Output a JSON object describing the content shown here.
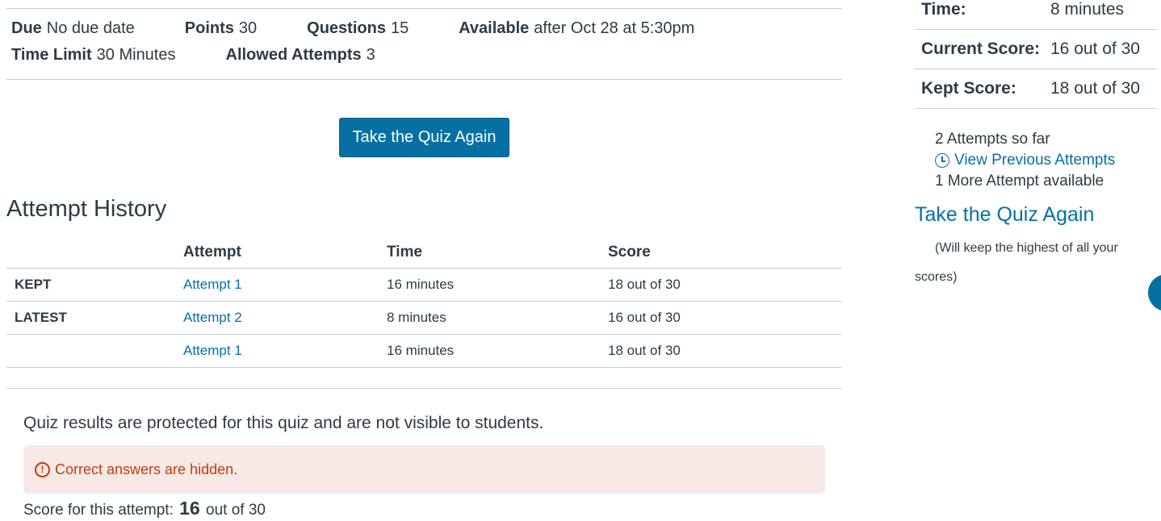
{
  "quiz_details": {
    "due_label": "Due",
    "due_value": "No due date",
    "points_label": "Points",
    "points_value": "30",
    "questions_label": "Questions",
    "questions_value": "15",
    "available_label": "Available",
    "available_value": "after Oct 28 at 5:30pm",
    "time_limit_label": "Time Limit",
    "time_limit_value": "30 Minutes",
    "allowed_attempts_label": "Allowed Attempts",
    "allowed_attempts_value": "3"
  },
  "take_quiz_button_label": "Take the Quiz Again",
  "attempt_history": {
    "title": "Attempt History",
    "columns": [
      "",
      "Attempt",
      "Time",
      "Score"
    ],
    "rows": [
      {
        "tag": "KEPT",
        "attempt": "Attempt 1",
        "time": "16 minutes",
        "score": "18 out of 30"
      },
      {
        "tag": "LATEST",
        "attempt": "Attempt 2",
        "time": "8 minutes",
        "score": "16 out of 30"
      },
      {
        "tag": "",
        "attempt": "Attempt 1",
        "time": "16 minutes",
        "score": "18 out of 30"
      }
    ]
  },
  "results": {
    "protected_text": "Quiz results are protected for this quiz and are not visible to students.",
    "alert_text": "Correct answers are hidden.",
    "score_prefix": "Score for this attempt:",
    "score_value": "16",
    "score_suffix": "out of 30"
  },
  "sidebar": {
    "time_label": "Time:",
    "time_value": "8 minutes",
    "current_score_label": "Current Score:",
    "current_score_value": "16 out of 30",
    "kept_score_label": "Kept Score:",
    "kept_score_value": "18 out of 30",
    "attempts_so_far": "2 Attempts so far",
    "view_previous": "View Previous Attempts",
    "more_attempts": "1 More Attempt available",
    "take_again_link": "Take the Quiz Again",
    "keep_note": "(Will keep the highest of all your scores)"
  }
}
